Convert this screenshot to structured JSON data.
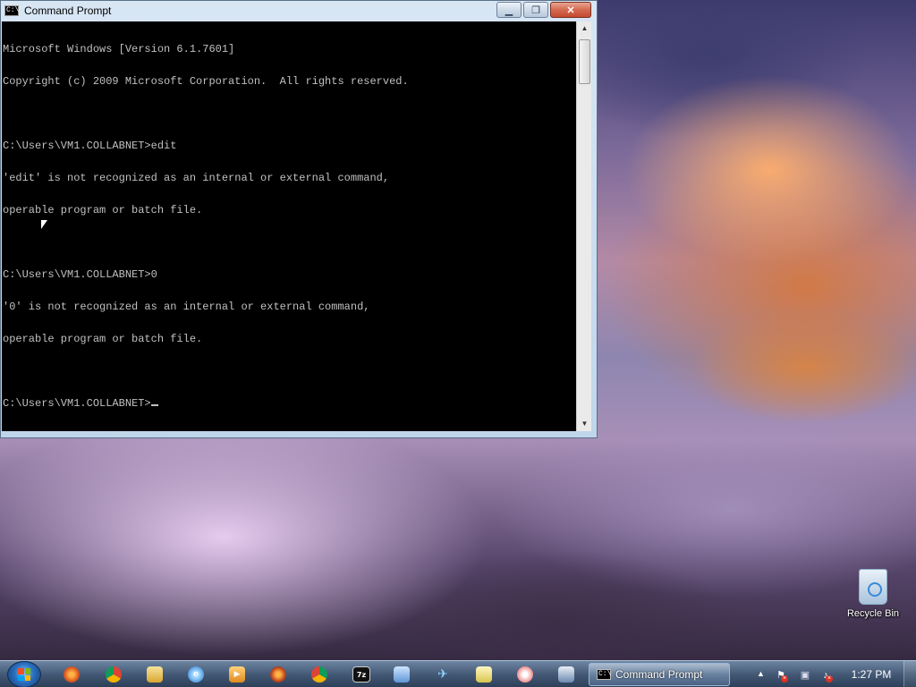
{
  "window": {
    "title": "Command Prompt",
    "icon_text": "C:\\",
    "minimize_symbol": "▁",
    "maximize_symbol": "❐",
    "close_symbol": "✕"
  },
  "console": {
    "lines": [
      "Microsoft Windows [Version 6.1.7601]",
      "Copyright (c) 2009 Microsoft Corporation.  All rights reserved.",
      "",
      "C:\\Users\\VM1.COLLABNET>edit",
      "'edit' is not recognized as an internal or external command,",
      "operable program or batch file.",
      "",
      "C:\\Users\\VM1.COLLABNET>0",
      "'0' is not recognized as an internal or external command,",
      "operable program or batch file.",
      "",
      "C:\\Users\\VM1.COLLABNET>"
    ]
  },
  "desktop": {
    "icons": [
      {
        "label": "Recycle Bin",
        "icon": "recycle-bin-icon"
      }
    ]
  },
  "taskbar": {
    "pinned": [
      {
        "name": "firefox-icon",
        "glyph": ""
      },
      {
        "name": "chrome-icon",
        "glyph": ""
      },
      {
        "name": "windows-explorer-icon",
        "glyph": ""
      },
      {
        "name": "internet-explorer-icon",
        "glyph": "e"
      },
      {
        "name": "media-player-icon",
        "glyph": "▶"
      },
      {
        "name": "firefox-alt-icon",
        "glyph": ""
      },
      {
        "name": "chrome-alt-icon",
        "glyph": ""
      },
      {
        "name": "7zip-icon",
        "glyph": "7z"
      },
      {
        "name": "network-icon",
        "glyph": ""
      },
      {
        "name": "plane-icon",
        "glyph": "✈"
      },
      {
        "name": "notes-icon",
        "glyph": ""
      },
      {
        "name": "paint-icon",
        "glyph": ""
      },
      {
        "name": "tool-icon",
        "glyph": ""
      }
    ],
    "active_task": {
      "label": "Command Prompt",
      "icon_text": "C:\\"
    },
    "tray": {
      "show_hidden_symbol": "▲",
      "clock": "1:27 PM"
    }
  }
}
